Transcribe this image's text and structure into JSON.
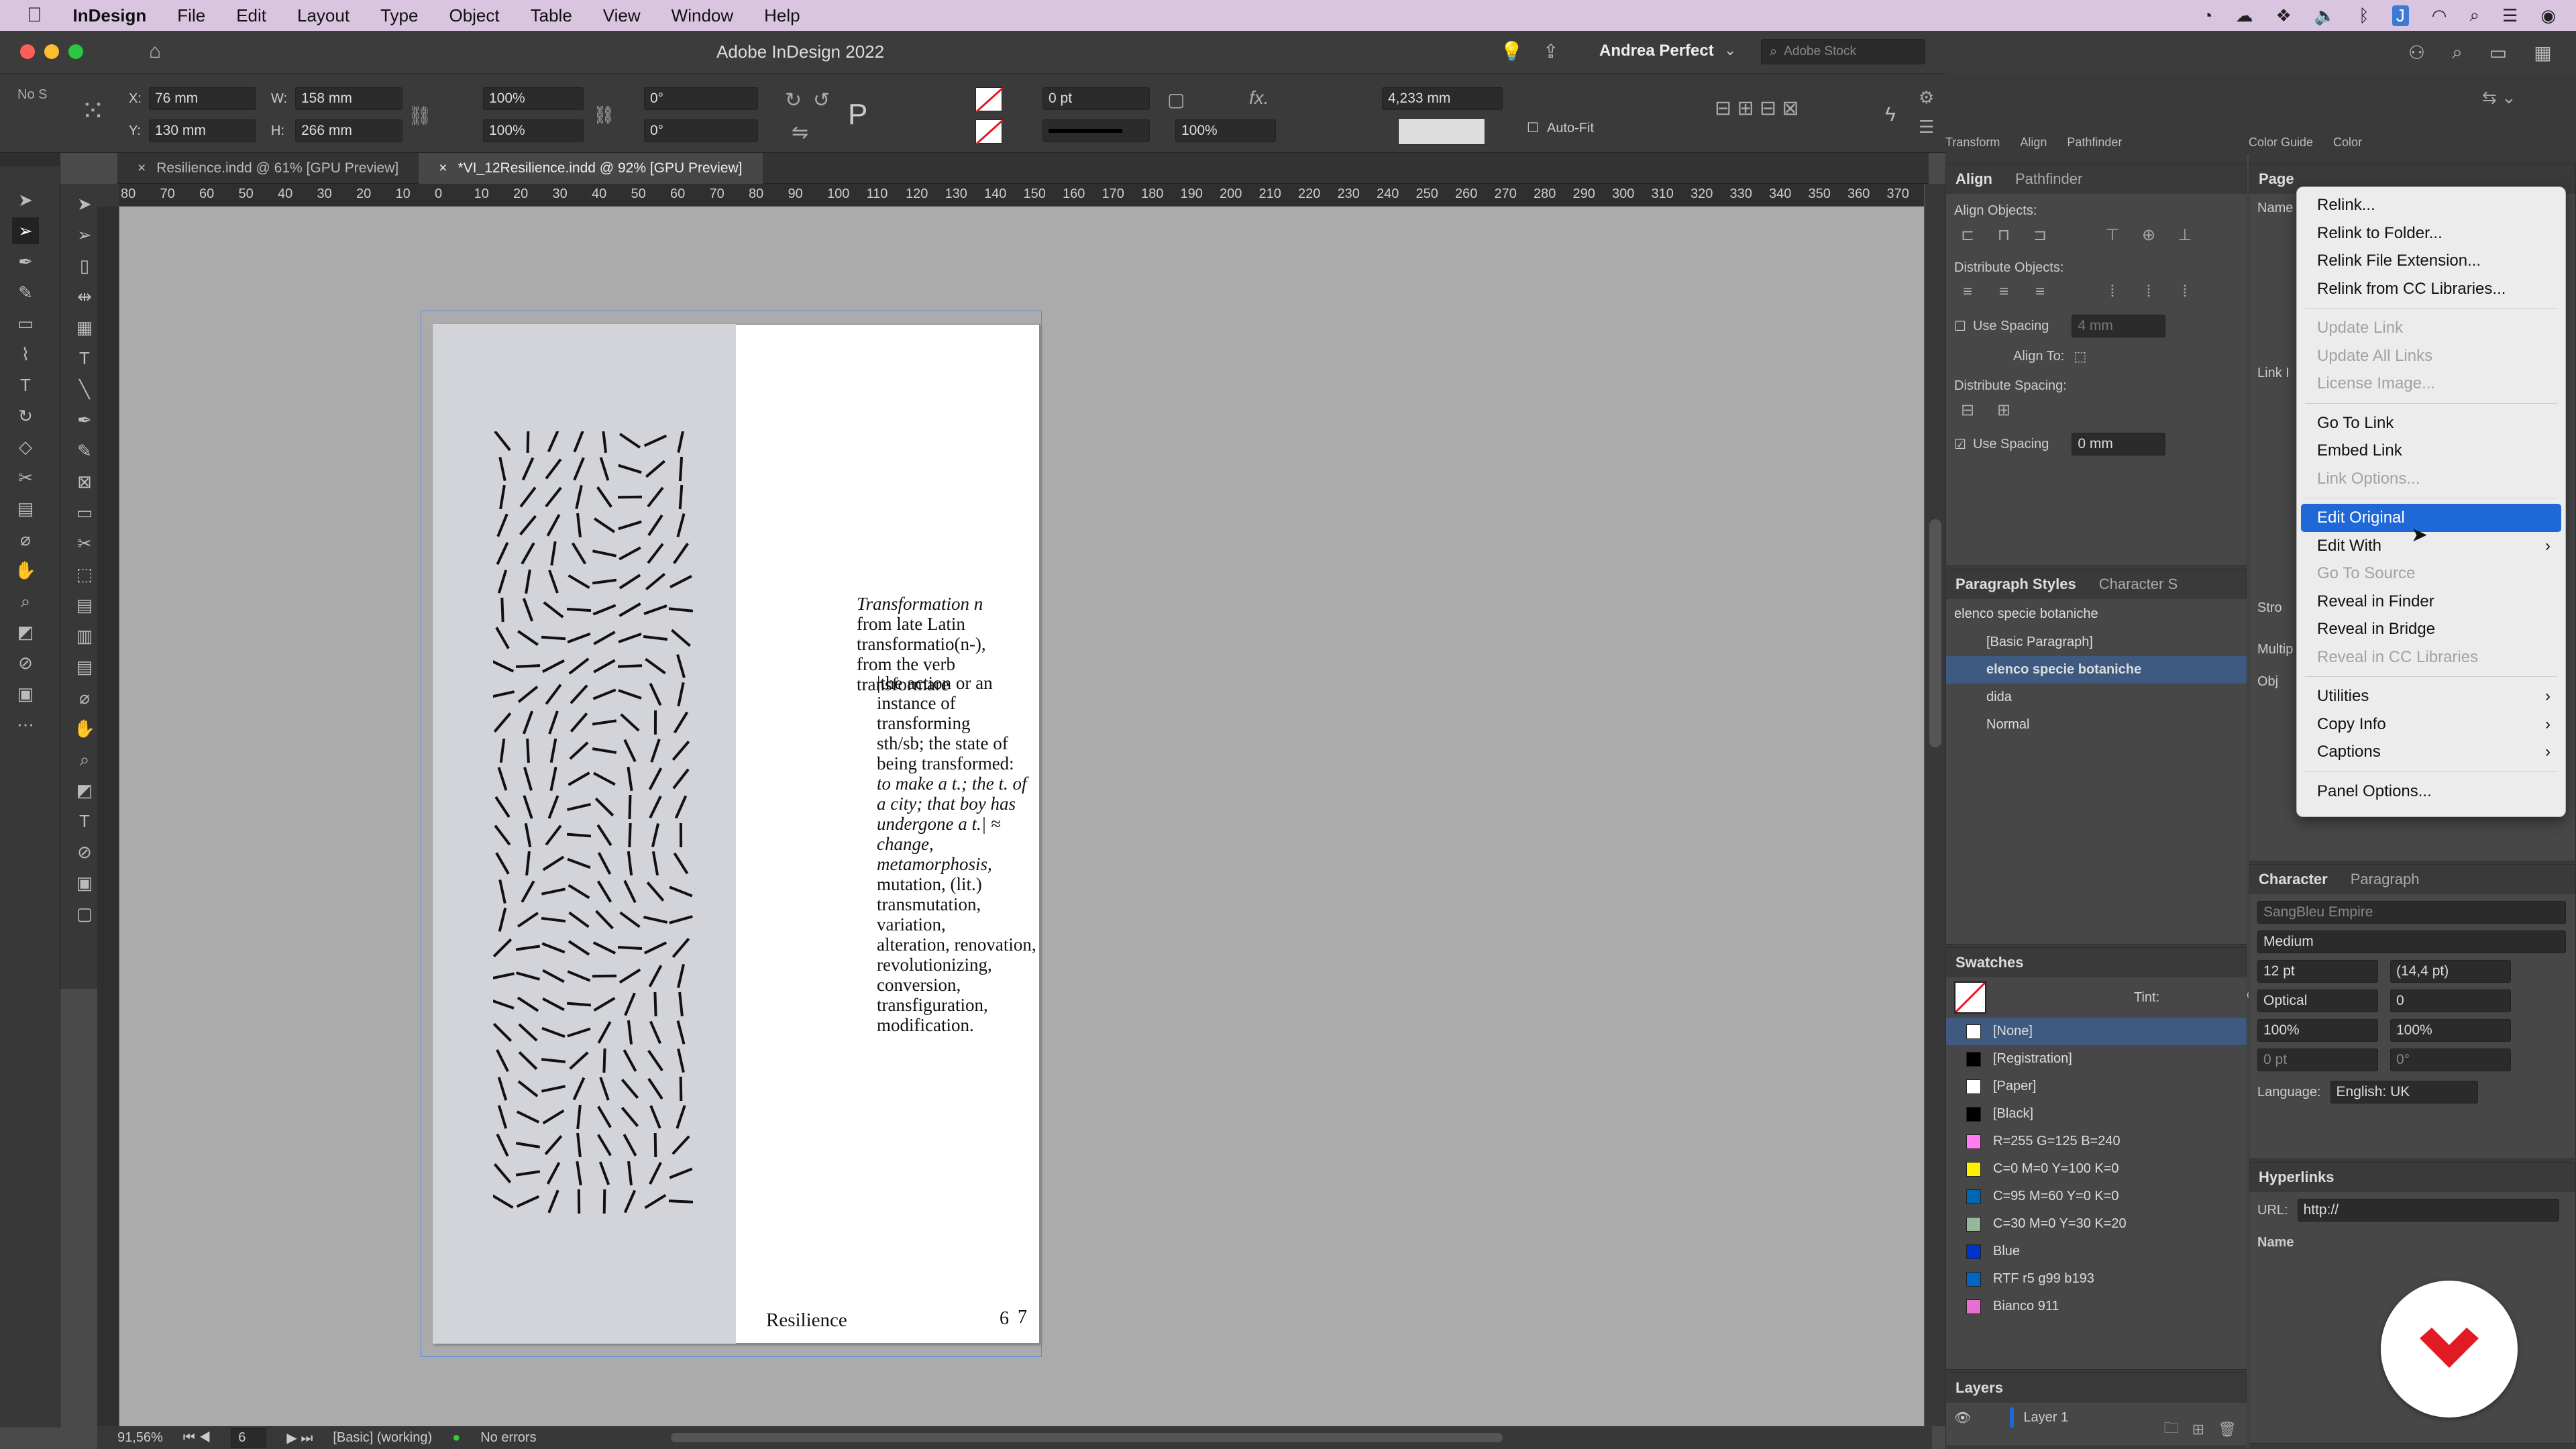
{
  "menubar": {
    "app": "InDesign",
    "items": [
      "File",
      "Edit",
      "Layout",
      "Type",
      "Object",
      "Table",
      "View",
      "Window",
      "Help"
    ]
  },
  "title": {
    "text": "Adobe InDesign 2022",
    "user": "Andrea Perfect",
    "search_placeholder": "Adobe Stock"
  },
  "control": {
    "x": "76 mm",
    "y": "130 mm",
    "w": "158 mm",
    "h": "266 mm",
    "scale_x": "100%",
    "scale_y": "100%",
    "angle": "0°",
    "shear": "0°",
    "stroke_weight": "0 pt",
    "opacity": "100%",
    "gap": "4,233 mm",
    "autofit": "Auto-Fit",
    "no_selection": "No S"
  },
  "tabs": [
    {
      "label": "Resilience.indd @ 61% [GPU Preview]"
    },
    {
      "label": "*VI_12Resilience.indd @ 92% [GPU Preview]"
    }
  ],
  "ruler": {
    "ticks": [
      "80",
      "70",
      "60",
      "50",
      "40",
      "30",
      "20",
      "10",
      "0",
      "10",
      "20",
      "30",
      "40",
      "50",
      "60",
      "70",
      "80",
      "90",
      "100",
      "110",
      "120",
      "130",
      "140",
      "150",
      "160",
      "170",
      "180",
      "190",
      "200",
      "210",
      "220",
      "230",
      "240",
      "250",
      "260",
      "270",
      "280",
      "290",
      "300",
      "310",
      "320",
      "330",
      "340",
      "350",
      "360",
      "370"
    ]
  },
  "page_text": {
    "line1": "Transformation n",
    "line2": "from late Latin transformatio(n-),",
    "line3": "from the verb transformare",
    "para1": "|the action or an instance of transforming",
    "para2": "sth/sb; the state of being transformed:",
    "para3": "to make a t.; the t. of a city; that boy has",
    "para4": "undergone a t.| ≈ change, metamorphosis,",
    "para5": "mutation, (lit.) transmutation, variation,",
    "para6": "alteration, renovation, revolutionizing,",
    "para7": "conversion, transfiguration, modification.",
    "folio_left": "6",
    "folio_right": "7",
    "running_head": "Resilience"
  },
  "status": {
    "zoom": "91,56%",
    "page": "6",
    "style": "[Basic] (working)",
    "errors": "No errors"
  },
  "align_panel": {
    "tabs": [
      "Align",
      "Pathfinder"
    ],
    "top_tabs": [
      "Transform",
      "Align",
      "Pathfinder"
    ],
    "align_objects": "Align Objects:",
    "distribute_objects": "Distribute Objects:",
    "use_spacing": "Use Spacing",
    "spacing_value": "4 mm",
    "align_to": "Align To:",
    "distribute_spacing": "Distribute Spacing:",
    "use_spacing2": "Use Spacing",
    "spacing_value2": "0 mm"
  },
  "para_styles": {
    "tabs": [
      "Paragraph Styles",
      "Character S"
    ],
    "current": "elenco specie botaniche",
    "items": [
      "[Basic Paragraph]",
      "elenco specie botaniche",
      "dida",
      "Normal"
    ]
  },
  "swatches": {
    "title": "Swatches",
    "tint_label": "Tint:",
    "tint_unit": "%",
    "items": [
      {
        "name": "[None]",
        "color": "#ffffff"
      },
      {
        "name": "[Registration]",
        "color": "#000000"
      },
      {
        "name": "[Paper]",
        "color": "#ffffff"
      },
      {
        "name": "[Black]",
        "color": "#000000"
      },
      {
        "name": "R=255 G=125 B=240",
        "color": "#ff7df0"
      },
      {
        "name": "C=0 M=0 Y=100 K=0",
        "color": "#fff200"
      },
      {
        "name": "C=95 M=60 Y=0 K=0",
        "color": "#0066b3"
      },
      {
        "name": "C=30 M=0 Y=30 K=20",
        "color": "#96b89a"
      },
      {
        "name": "Blue",
        "color": "#0033cc"
      },
      {
        "name": "RTF r5 g99 b193",
        "color": "#0563c1"
      },
      {
        "name": "Bianco 911",
        "color": "#e86fd0"
      }
    ]
  },
  "layers": {
    "title": "Layers",
    "items": [
      "Layer 1"
    ]
  },
  "right_panel": {
    "top_tabs": [
      "Color Guide",
      "Color"
    ],
    "side_tabs": [
      "Page",
      "Name"
    ],
    "link_info": "Link I",
    "stroke": "Stro",
    "multiply": "Multip",
    "obj": "Obj"
  },
  "context_menu": {
    "items": [
      {
        "label": "Relink...",
        "state": "enabled"
      },
      {
        "label": "Relink to Folder...",
        "state": "enabled"
      },
      {
        "label": "Relink File Extension...",
        "state": "enabled"
      },
      {
        "label": "Relink from CC Libraries...",
        "state": "enabled"
      },
      {
        "label": "Update Link",
        "state": "disabled"
      },
      {
        "label": "Update All Links",
        "state": "disabled"
      },
      {
        "label": "License Image...",
        "state": "disabled"
      },
      {
        "label": "Go To Link",
        "state": "enabled"
      },
      {
        "label": "Embed Link",
        "state": "enabled"
      },
      {
        "label": "Link Options...",
        "state": "disabled"
      },
      {
        "label": "Edit Original",
        "state": "highlighted"
      },
      {
        "label": "Edit With",
        "state": "submenu"
      },
      {
        "label": "Go To Source",
        "state": "disabled"
      },
      {
        "label": "Reveal in Finder",
        "state": "enabled"
      },
      {
        "label": "Reveal in Bridge",
        "state": "enabled"
      },
      {
        "label": "Reveal in CC Libraries",
        "state": "disabled"
      },
      {
        "label": "Utilities",
        "state": "submenu"
      },
      {
        "label": "Copy Info",
        "state": "submenu"
      },
      {
        "label": "Captions",
        "state": "submenu"
      },
      {
        "label": "Panel Options...",
        "state": "enabled"
      }
    ]
  },
  "character": {
    "tabs": [
      "Character",
      "Paragraph"
    ],
    "font": "SangBleu Empire",
    "style": "Medium",
    "size": "12 pt",
    "leading": "(14,4 pt)",
    "kerning": "Optical",
    "tracking": "0",
    "vscale": "100%",
    "hscale": "100%",
    "baseline": "0 pt",
    "skew": "0°",
    "language_label": "Language:",
    "language": "English: UK"
  },
  "hyperlinks": {
    "title": "Hyperlinks",
    "url_label": "URL:",
    "url": "http://",
    "name_col": "Name"
  },
  "colors": {
    "accent": "#1f68d8",
    "selection": "#4b8cf7",
    "menubar": "#d9c5e0",
    "badge": "#e01b24"
  }
}
